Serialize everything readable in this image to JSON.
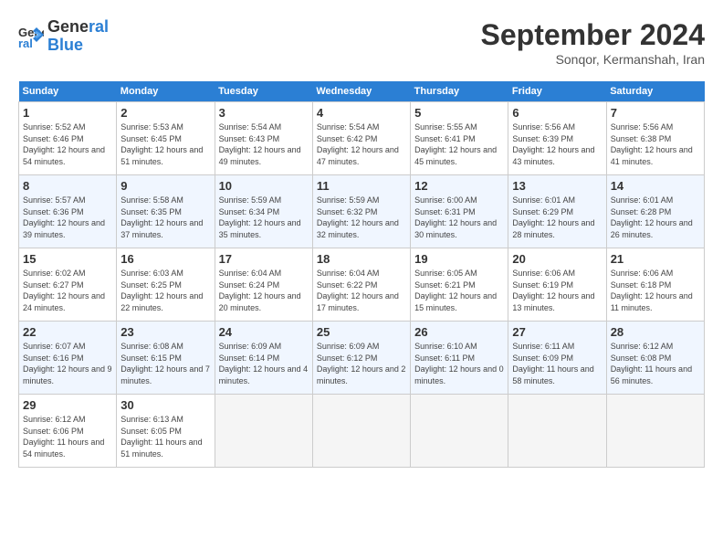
{
  "logo": {
    "line1": "General",
    "line2": "Blue"
  },
  "title": "September 2024",
  "subtitle": "Sonqor, Kermanshah, Iran",
  "weekdays": [
    "Sunday",
    "Monday",
    "Tuesday",
    "Wednesday",
    "Thursday",
    "Friday",
    "Saturday"
  ],
  "weeks": [
    [
      {
        "day": "1",
        "sunrise": "5:52 AM",
        "sunset": "6:46 PM",
        "daylight": "12 hours and 54 minutes."
      },
      {
        "day": "2",
        "sunrise": "5:53 AM",
        "sunset": "6:45 PM",
        "daylight": "12 hours and 51 minutes."
      },
      {
        "day": "3",
        "sunrise": "5:54 AM",
        "sunset": "6:43 PM",
        "daylight": "12 hours and 49 minutes."
      },
      {
        "day": "4",
        "sunrise": "5:54 AM",
        "sunset": "6:42 PM",
        "daylight": "12 hours and 47 minutes."
      },
      {
        "day": "5",
        "sunrise": "5:55 AM",
        "sunset": "6:41 PM",
        "daylight": "12 hours and 45 minutes."
      },
      {
        "day": "6",
        "sunrise": "5:56 AM",
        "sunset": "6:39 PM",
        "daylight": "12 hours and 43 minutes."
      },
      {
        "day": "7",
        "sunrise": "5:56 AM",
        "sunset": "6:38 PM",
        "daylight": "12 hours and 41 minutes."
      }
    ],
    [
      {
        "day": "8",
        "sunrise": "5:57 AM",
        "sunset": "6:36 PM",
        "daylight": "12 hours and 39 minutes."
      },
      {
        "day": "9",
        "sunrise": "5:58 AM",
        "sunset": "6:35 PM",
        "daylight": "12 hours and 37 minutes."
      },
      {
        "day": "10",
        "sunrise": "5:59 AM",
        "sunset": "6:34 PM",
        "daylight": "12 hours and 35 minutes."
      },
      {
        "day": "11",
        "sunrise": "5:59 AM",
        "sunset": "6:32 PM",
        "daylight": "12 hours and 32 minutes."
      },
      {
        "day": "12",
        "sunrise": "6:00 AM",
        "sunset": "6:31 PM",
        "daylight": "12 hours and 30 minutes."
      },
      {
        "day": "13",
        "sunrise": "6:01 AM",
        "sunset": "6:29 PM",
        "daylight": "12 hours and 28 minutes."
      },
      {
        "day": "14",
        "sunrise": "6:01 AM",
        "sunset": "6:28 PM",
        "daylight": "12 hours and 26 minutes."
      }
    ],
    [
      {
        "day": "15",
        "sunrise": "6:02 AM",
        "sunset": "6:27 PM",
        "daylight": "12 hours and 24 minutes."
      },
      {
        "day": "16",
        "sunrise": "6:03 AM",
        "sunset": "6:25 PM",
        "daylight": "12 hours and 22 minutes."
      },
      {
        "day": "17",
        "sunrise": "6:04 AM",
        "sunset": "6:24 PM",
        "daylight": "12 hours and 20 minutes."
      },
      {
        "day": "18",
        "sunrise": "6:04 AM",
        "sunset": "6:22 PM",
        "daylight": "12 hours and 17 minutes."
      },
      {
        "day": "19",
        "sunrise": "6:05 AM",
        "sunset": "6:21 PM",
        "daylight": "12 hours and 15 minutes."
      },
      {
        "day": "20",
        "sunrise": "6:06 AM",
        "sunset": "6:19 PM",
        "daylight": "12 hours and 13 minutes."
      },
      {
        "day": "21",
        "sunrise": "6:06 AM",
        "sunset": "6:18 PM",
        "daylight": "12 hours and 11 minutes."
      }
    ],
    [
      {
        "day": "22",
        "sunrise": "6:07 AM",
        "sunset": "6:16 PM",
        "daylight": "12 hours and 9 minutes."
      },
      {
        "day": "23",
        "sunrise": "6:08 AM",
        "sunset": "6:15 PM",
        "daylight": "12 hours and 7 minutes."
      },
      {
        "day": "24",
        "sunrise": "6:09 AM",
        "sunset": "6:14 PM",
        "daylight": "12 hours and 4 minutes."
      },
      {
        "day": "25",
        "sunrise": "6:09 AM",
        "sunset": "6:12 PM",
        "daylight": "12 hours and 2 minutes."
      },
      {
        "day": "26",
        "sunrise": "6:10 AM",
        "sunset": "6:11 PM",
        "daylight": "12 hours and 0 minutes."
      },
      {
        "day": "27",
        "sunrise": "6:11 AM",
        "sunset": "6:09 PM",
        "daylight": "11 hours and 58 minutes."
      },
      {
        "day": "28",
        "sunrise": "6:12 AM",
        "sunset": "6:08 PM",
        "daylight": "11 hours and 56 minutes."
      }
    ],
    [
      {
        "day": "29",
        "sunrise": "6:12 AM",
        "sunset": "6:06 PM",
        "daylight": "11 hours and 54 minutes."
      },
      {
        "day": "30",
        "sunrise": "6:13 AM",
        "sunset": "6:05 PM",
        "daylight": "11 hours and 51 minutes."
      },
      null,
      null,
      null,
      null,
      null
    ]
  ]
}
